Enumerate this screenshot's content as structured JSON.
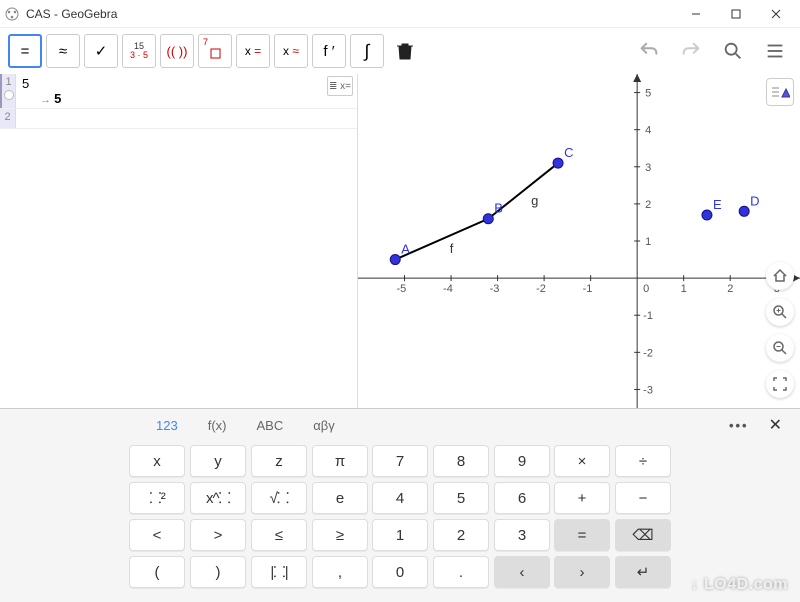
{
  "window": {
    "title": "CAS - GeoGebra"
  },
  "toolbar": {
    "equals": "=",
    "approx": "≈",
    "check": "✓",
    "frac_num": "15",
    "frac_den": "3 · 5",
    "paren": "(( ))",
    "keep": "7",
    "xeq": "x =",
    "xapprox": "x ≈",
    "deriv": "f ′",
    "integral": "∫",
    "trash": "🗑"
  },
  "app_bar": {
    "undo": "↶",
    "redo": "↷",
    "search": "🔍",
    "menu": "≡"
  },
  "cas": {
    "rows": [
      {
        "index": "1",
        "input": "5",
        "result": "5"
      },
      {
        "index": "2",
        "input": "",
        "result": ""
      }
    ],
    "toggle": "≣ x="
  },
  "graph_toggle": "≣▲",
  "graph_side": {
    "home": "⌂",
    "zoom_in": "🔍",
    "zoom_out": "🔍",
    "fullscreen": "⛶"
  },
  "chart_data": {
    "type": "scatter",
    "xlim": [
      -6,
      3.5
    ],
    "ylim": [
      -3.5,
      5.5
    ],
    "points": [
      {
        "name": "A",
        "x": -5.2,
        "y": 0.5
      },
      {
        "name": "B",
        "x": -3.2,
        "y": 1.6
      },
      {
        "name": "C",
        "x": -1.7,
        "y": 3.1
      },
      {
        "name": "D",
        "x": 2.3,
        "y": 1.8
      },
      {
        "name": "E",
        "x": 1.5,
        "y": 1.7
      }
    ],
    "segments": [
      {
        "name": "f",
        "from": "A",
        "to": "B"
      },
      {
        "name": "g",
        "from": "B",
        "to": "C"
      }
    ],
    "x_ticks": [
      -5,
      -4,
      -3,
      -2,
      -1,
      0,
      1,
      2,
      3
    ],
    "y_ticks": [
      -3,
      -2,
      -1,
      1,
      2,
      3,
      4,
      5
    ]
  },
  "keyboard": {
    "tabs": {
      "num": "123",
      "fx": "f(x)",
      "abc": "ABC",
      "greek": "αβγ"
    },
    "more": "•••",
    "close": "✕",
    "vars": {
      "r1": [
        "x",
        "y",
        "z",
        "π"
      ],
      "r2": [
        "⸬²",
        "x^⸬",
        "√⸬",
        "e"
      ],
      "r3": [
        "<",
        ">",
        "≤",
        "≥"
      ],
      "r4": [
        "(",
        ")",
        "|⸬|",
        ","
      ]
    },
    "nums": {
      "r1": [
        "7",
        "8",
        "9"
      ],
      "r2": [
        "4",
        "5",
        "6"
      ],
      "r3": [
        "1",
        "2",
        "3"
      ],
      "r4": [
        "0",
        ".",
        ""
      ]
    },
    "ops": {
      "r1": [
        "×",
        "÷"
      ],
      "r2": [
        "+",
        "−"
      ],
      "r3": [
        "",
        "⌫"
      ],
      "r4": [
        "",
        ""
      ]
    },
    "nav": {
      "left": "‹",
      "right": "›",
      "enter": "↵"
    }
  },
  "watermark": "↓ LO4D.com"
}
